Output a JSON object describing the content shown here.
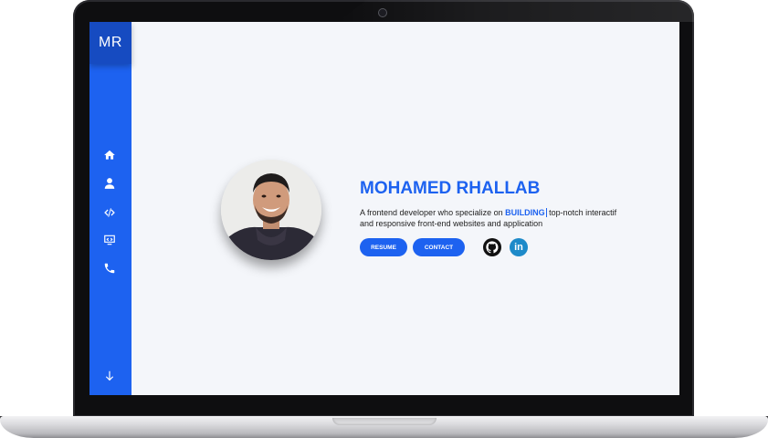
{
  "sidebar": {
    "logo_text": "MR",
    "nav_items": [
      {
        "icon": "home-icon"
      },
      {
        "icon": "user-icon"
      },
      {
        "icon": "code-icon"
      },
      {
        "icon": "monitor-icon"
      },
      {
        "icon": "phone-icon"
      }
    ],
    "scroll_icon": "arrow-down-icon"
  },
  "hero": {
    "name": "MOHAMED RHALLAB",
    "description_prefix": "A frontend developer who specialize on ",
    "description_highlight": "BUILDING",
    "description_suffix": " top-notch interactif",
    "description_line2": "and responsive front-end websites and application",
    "resume_label": "RESUME",
    "contact_label": "CONTACT",
    "social_links": [
      "github-icon",
      "linkedin-icon"
    ],
    "linkedin_text": "in"
  },
  "colors": {
    "accent": "#1d62f0",
    "sidebar": "#1d62f0",
    "logo_bg": "#164bc1",
    "background": "#f4f6fa",
    "linkedin": "#1d8ac9"
  }
}
